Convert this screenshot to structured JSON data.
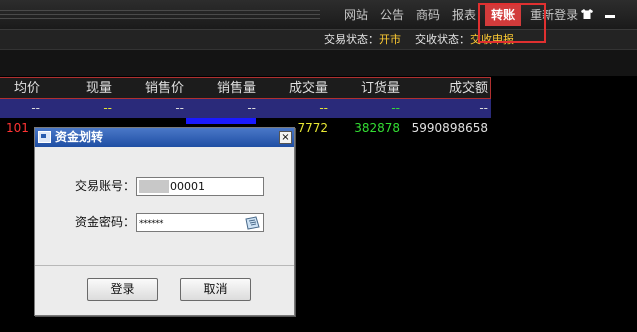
{
  "topnav": {
    "items": [
      {
        "label": "网站"
      },
      {
        "label": "公告"
      },
      {
        "label": "商码"
      },
      {
        "label": "报表"
      },
      {
        "label": "转账",
        "active": true
      },
      {
        "label": "重新登录"
      }
    ],
    "icons": [
      "shirt-icon",
      "minimize-icon"
    ]
  },
  "status": {
    "trade_label": "交易状态：",
    "trade_value": "开市",
    "delivery_label": "交收状态：",
    "delivery_value": "交收申报"
  },
  "table": {
    "headers": [
      "均价",
      "现量",
      "销售价",
      "销售量",
      "成交量",
      "订货量",
      "成交额"
    ],
    "dash_row": [
      "--",
      "--",
      "--",
      "--",
      "--",
      "--",
      "--"
    ],
    "data_row": {
      "first": "101",
      "volume": "7772",
      "order_qty": "382878",
      "turnover": "5990898658"
    }
  },
  "dialog": {
    "title": "资金划转",
    "close": "×",
    "account_label": "交易账号：",
    "account_value": "00001",
    "password_label": "资金密码：",
    "password_value": "******",
    "login_button": "登录",
    "cancel_button": "取消"
  },
  "colors": {
    "accent_red": "#d23b3b",
    "status_yellow": "#ffcc33",
    "row_select": "#2a2a7a"
  }
}
